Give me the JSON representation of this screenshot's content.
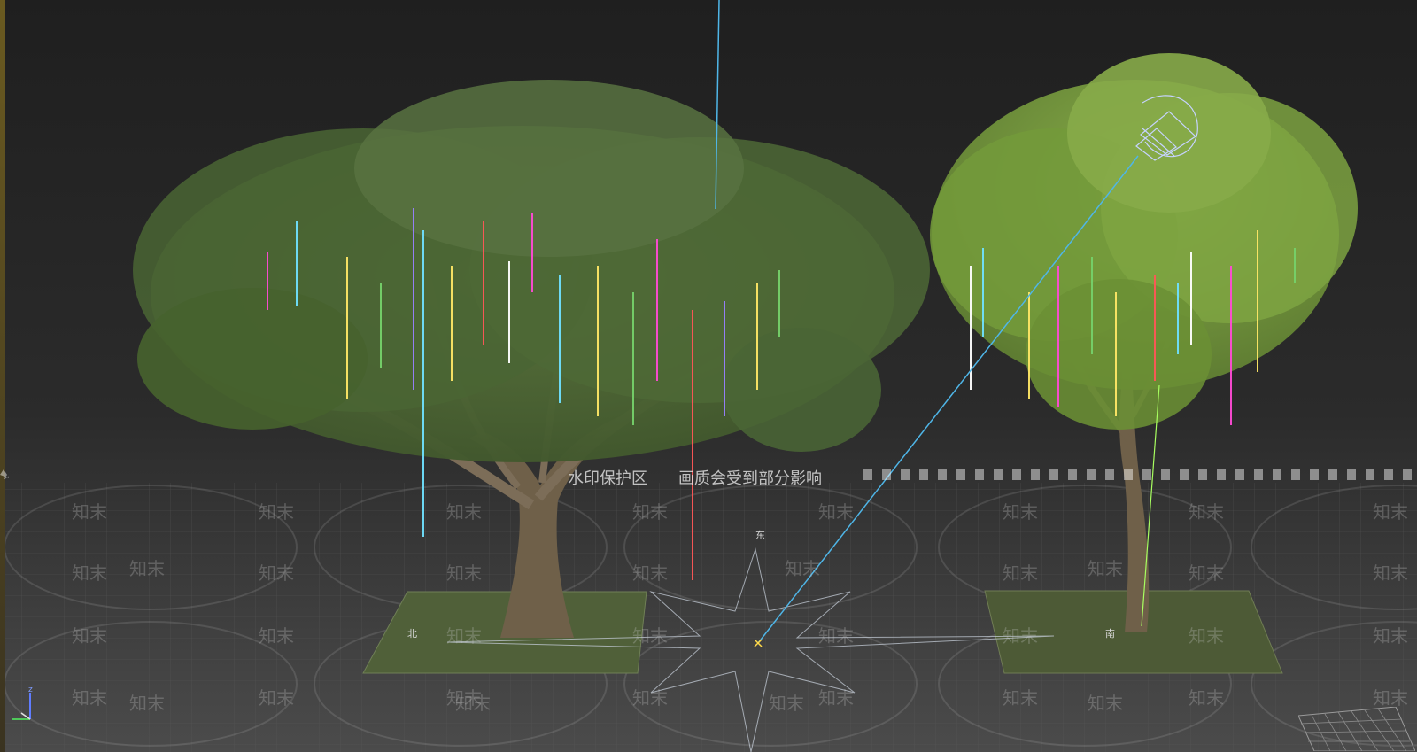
{
  "viewport": {
    "compass": {
      "north": "北",
      "east": "东",
      "south": "南"
    },
    "axis": {
      "z": "z"
    }
  },
  "watermark": {
    "banner_left": "水印保护区",
    "banner_right": "画质会受到部分影响",
    "brand": "知末"
  },
  "colors": {
    "background_top": "#202020",
    "background_bottom": "#454545",
    "grid": "#5a5a5a",
    "leaf_dark": "#536e37",
    "leaf_bright": "#7f9f3a",
    "trunk": "#6f6049",
    "ground": "#505c38",
    "selection_line": "#4fb6e8",
    "light_gizmo": "#b8c9ff",
    "ribbons": [
      "#ff4ad5",
      "#ffe766",
      "#6fe1ff",
      "#76d16a",
      "#ff5757",
      "#9880ff",
      "#ffffff"
    ]
  }
}
